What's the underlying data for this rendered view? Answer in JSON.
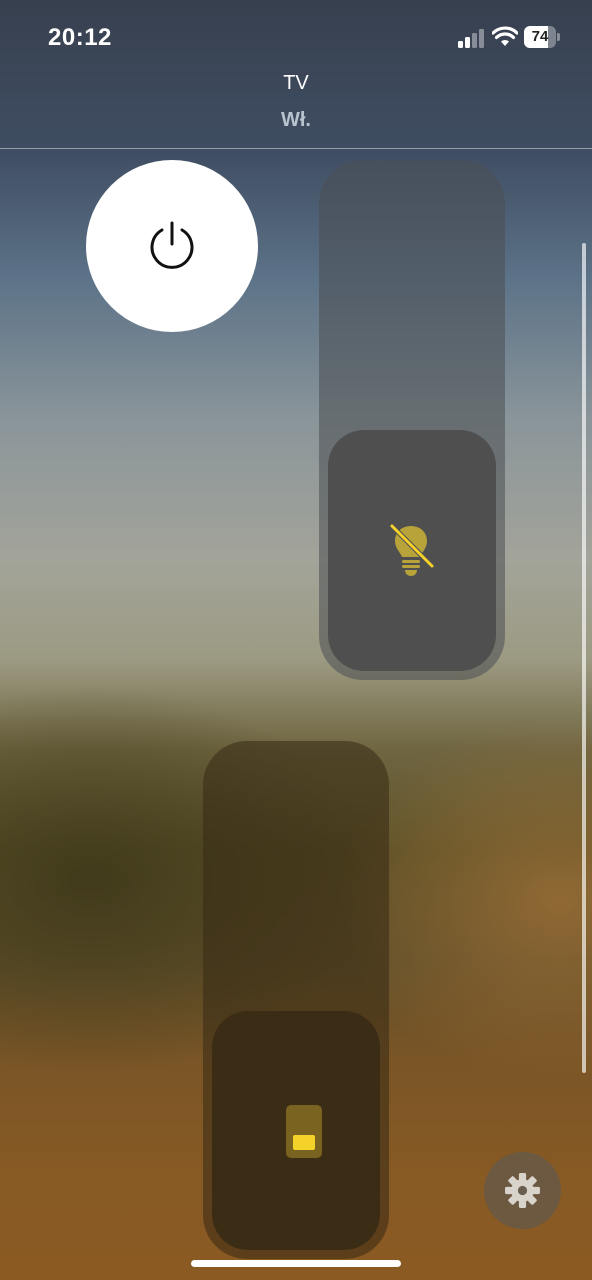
{
  "status_bar": {
    "time": "20:12",
    "battery_level": "74",
    "icons": [
      "cellular-signal-icon",
      "wifi-icon",
      "battery-icon"
    ]
  },
  "header": {
    "title": "TV",
    "status": "Wł."
  },
  "controls": {
    "power_button": {
      "icon": "power-icon"
    },
    "light_slider": {
      "icon": "lightbulb-off-icon",
      "level_fraction": 0.46
    },
    "tv_slider": {
      "icon": "tv-icon",
      "level_fraction": 0.46
    },
    "settings_button": {
      "icon": "gear-icon"
    }
  },
  "colors": {
    "accent_yellow": "#f5d22a",
    "muted_yellow": "#b8a33a",
    "power_button_bg": "#ffffff"
  }
}
